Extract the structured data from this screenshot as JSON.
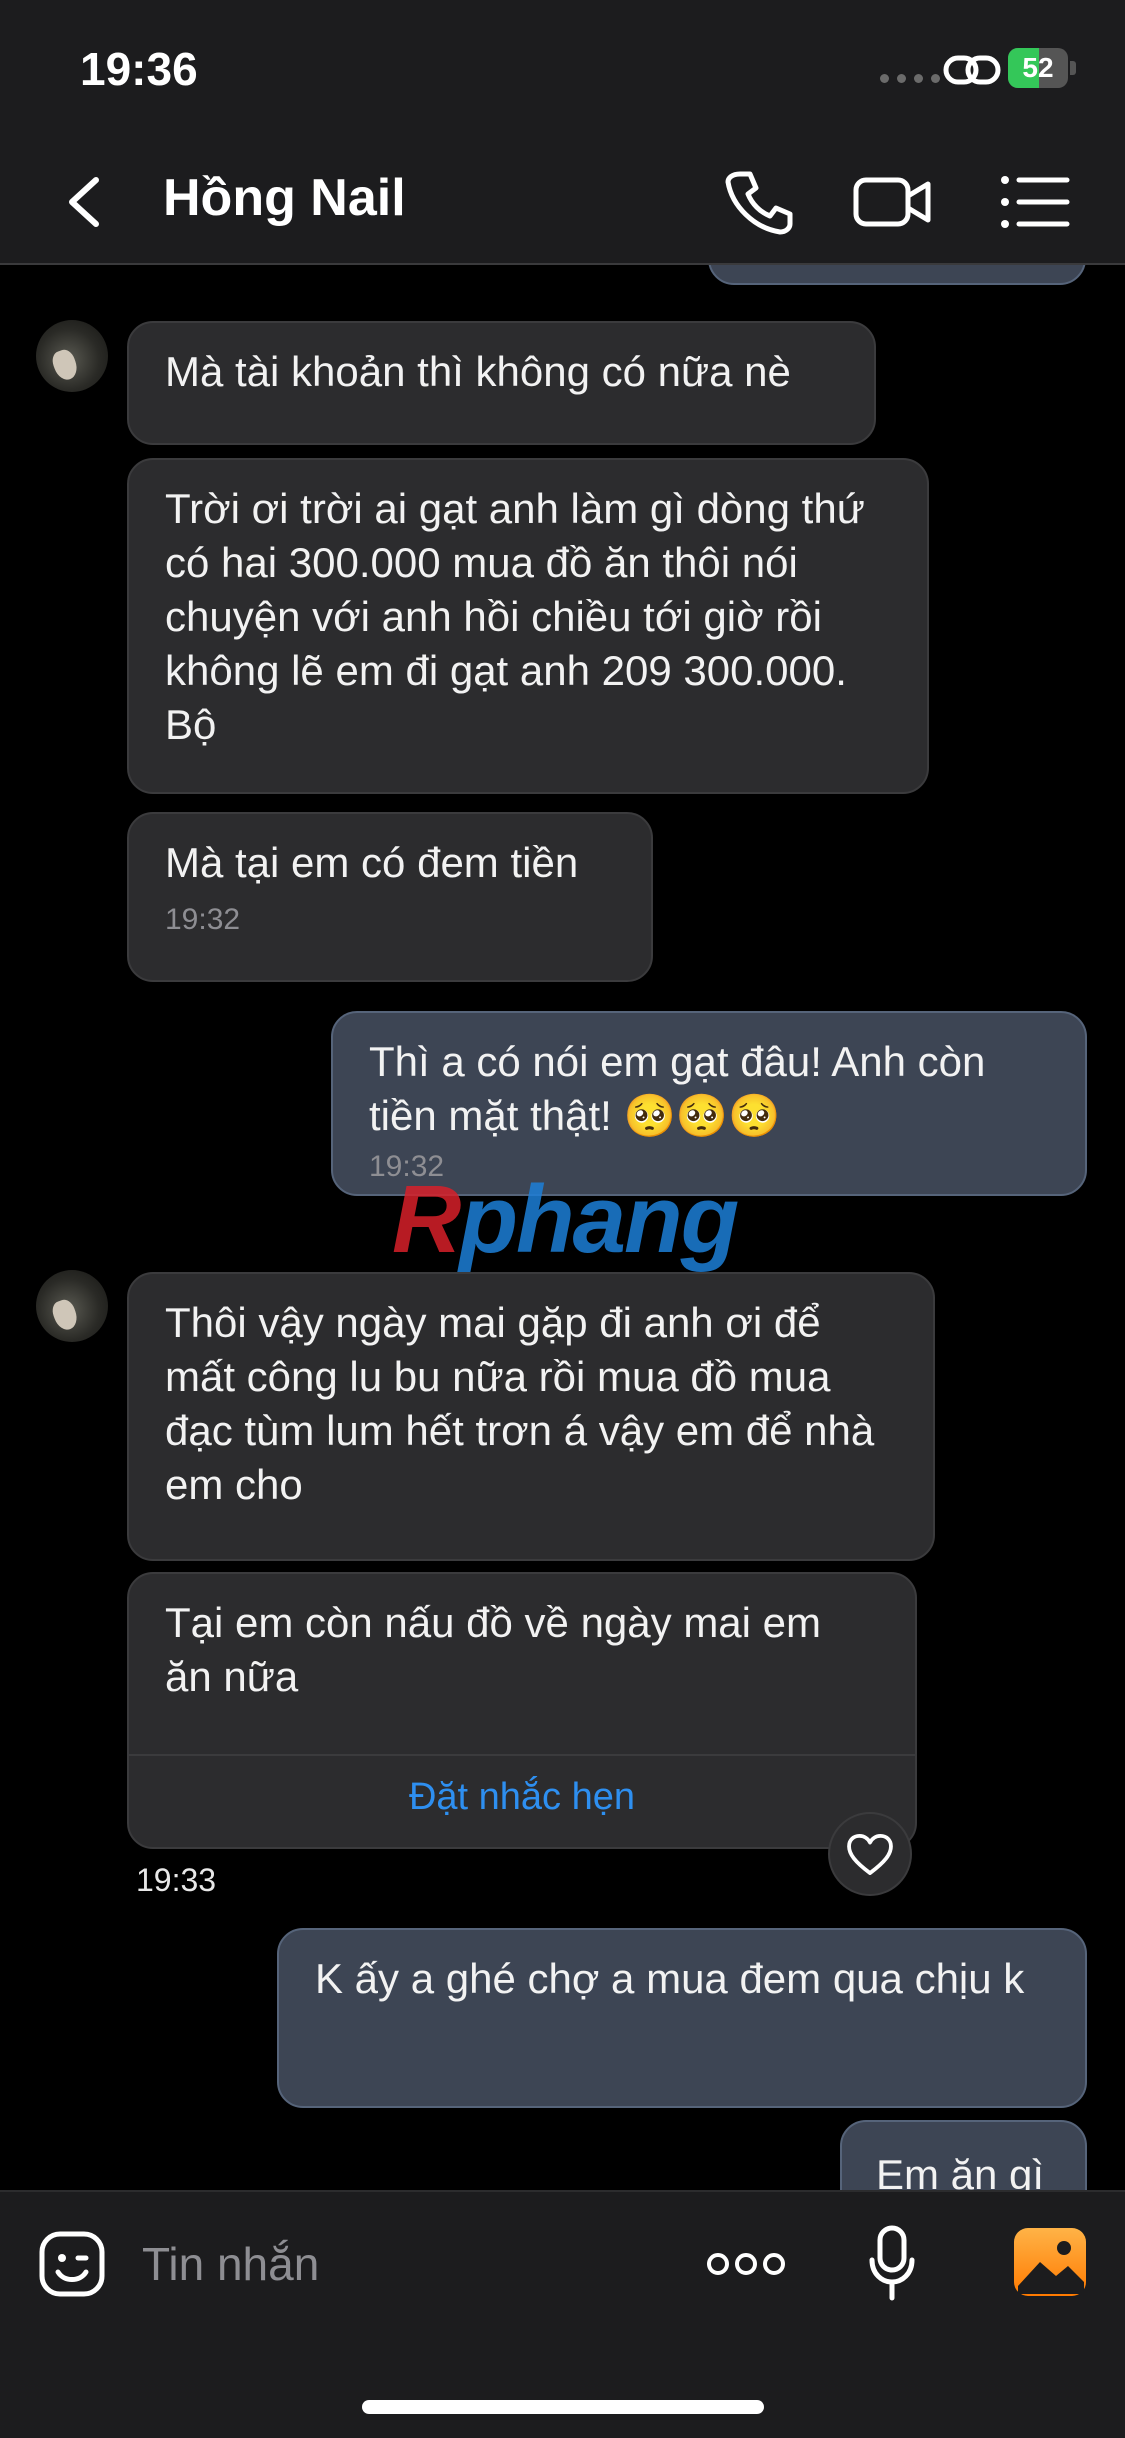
{
  "status_bar": {
    "time": "19:36",
    "battery": "52",
    "battery_level": 0.52
  },
  "header": {
    "contact_name": "Hồng Nail"
  },
  "messages": [
    {
      "text": "Mà tài khoản thì không có nữa nè"
    },
    {
      "text": "Trời ơi trời ai gạt anh làm gì dòng thứ có hai 300.000 mua đồ ăn thôi nói chuyện với anh hồi chiều tới giờ rồi không lẽ em đi gạt anh  209 300.000. Bộ"
    },
    {
      "text": "Mà tại em có đem tiền",
      "time": "19:32"
    },
    {
      "text": "Thì a có nói em gạt đâu! Anh còn tiền mặt thật! 🥺🥺🥺",
      "time": "19:32"
    },
    {
      "text": "Thôi vậy ngày mai gặp đi anh ơi để mất công lu bu nữa rồi mua đồ mua đạc tùm lum hết trơn á vậy em để nhà em cho"
    },
    {
      "text": "Tại em còn nấu đồ về ngày mai em ăn nữa",
      "action": "Đặt nhắc hẹn"
    },
    {
      "text": "K ấy a ghé chợ a mua đem qua chịu k"
    },
    {
      "text": "Em ăn gì"
    }
  ],
  "group_time": "19:33",
  "watermark": {
    "first": "R",
    "rest": "phang"
  },
  "input": {
    "placeholder": "Tin nhắn"
  },
  "colors": {
    "accent": "#2e8ff0",
    "battery": "#34c759",
    "outgoing": "#3d4554",
    "incoming": "#2c2c2e"
  }
}
